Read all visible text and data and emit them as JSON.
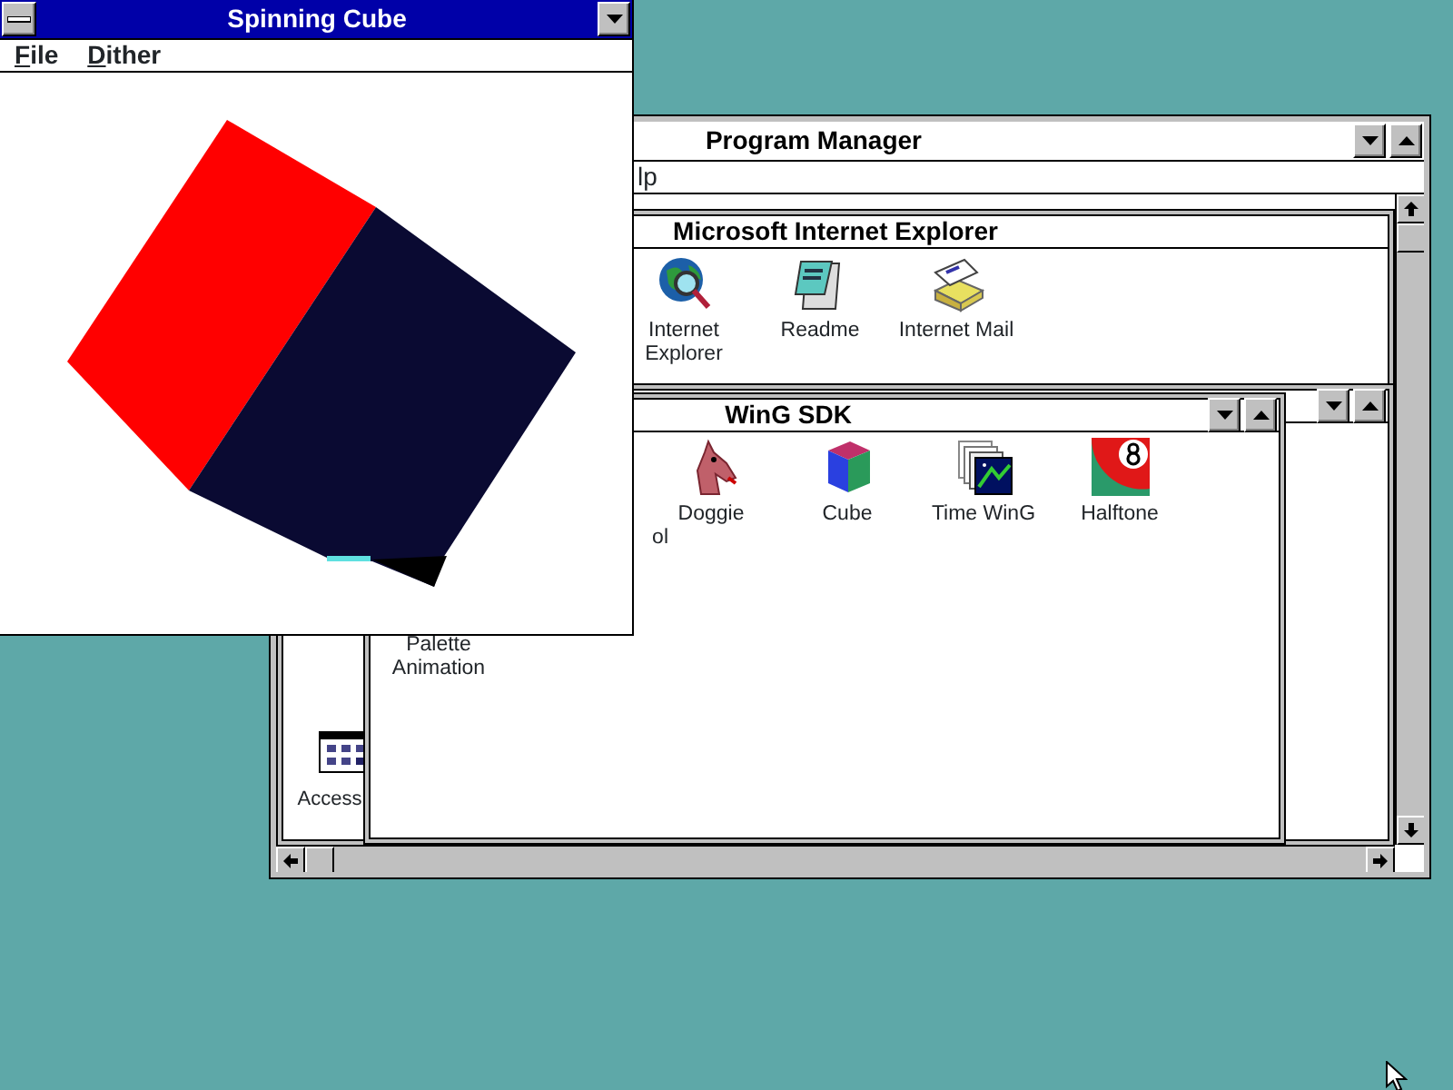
{
  "cube_window": {
    "title": "Spinning Cube",
    "active": true,
    "menu": [
      {
        "label": "File"
      },
      {
        "label": "Dither"
      }
    ]
  },
  "program_manager": {
    "title": "Program Manager",
    "active": false,
    "menu": [
      {
        "label": "lp"
      }
    ],
    "groups": [
      {
        "title": "Microsoft Internet Explorer",
        "items": [
          {
            "label": "Internet Explorer",
            "kind": "globe"
          },
          {
            "label": "Readme",
            "kind": "notepad"
          },
          {
            "label": "Internet Mail",
            "kind": "mail"
          }
        ]
      },
      {
        "title": "WinG SDK",
        "items": [
          {
            "label": "ol",
            "kind": "partial"
          },
          {
            "label": "Doggie",
            "kind": "dog"
          },
          {
            "label": "Cube",
            "kind": "cube"
          },
          {
            "label": "Time WinG",
            "kind": "frames"
          },
          {
            "label": "Halftone",
            "kind": "ball"
          },
          {
            "label": "Palette Animation",
            "kind": "hidden"
          }
        ]
      }
    ],
    "minimized_groups": [
      {
        "label": "Access",
        "kind": "group"
      }
    ]
  }
}
